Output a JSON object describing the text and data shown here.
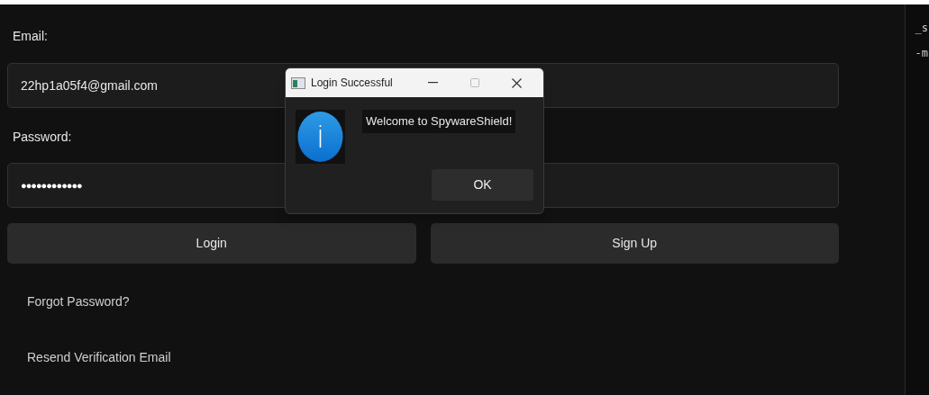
{
  "form": {
    "email_label": "Email:",
    "email_value": "22hp1a05f4@gmail.com",
    "password_label": "Password:",
    "password_value": "●●●●●●●●●●●●",
    "buttons": [
      "Login",
      "Sign Up"
    ],
    "links": [
      "Forgot Password?",
      "Resend Verification Email"
    ]
  },
  "terminal": {
    "lines": [
      "_s",
      "-m"
    ]
  },
  "dialog": {
    "title": "Login Successful",
    "message": "Welcome to SpywareShield!",
    "button": "OK"
  }
}
